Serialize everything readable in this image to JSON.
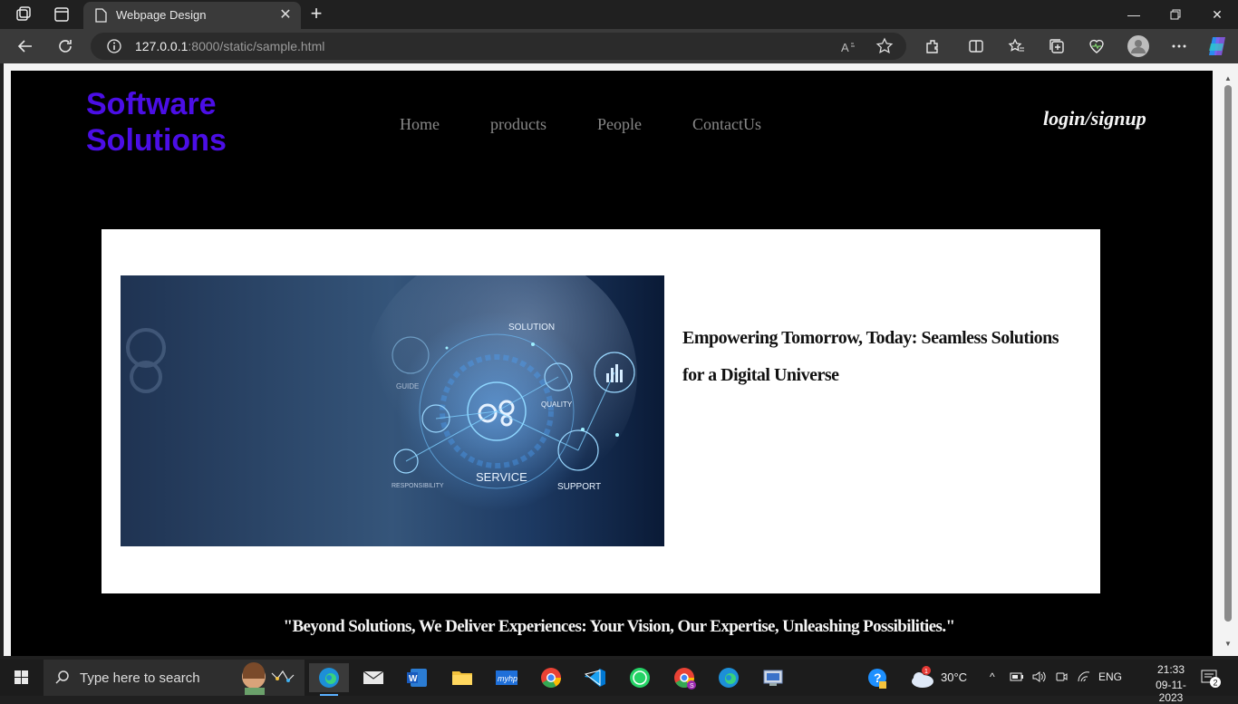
{
  "browser": {
    "tab_title": "Webpage Design",
    "url_host": "127.0.0.1",
    "url_rest": ":8000/static/sample.html",
    "accent": "#202020"
  },
  "site": {
    "brand_line1": "Software",
    "brand_line2": "Solutions",
    "brand_color": "#4b0ee6",
    "nav": [
      "Home",
      "products",
      "People",
      "ContactUs"
    ],
    "login": "login/signup",
    "hero_labels": {
      "solution": "SOLUTION",
      "guide": "GUIDE",
      "quality": "QUALITY",
      "service": "SERVICE",
      "responsibility": "RESPONSIBILITY",
      "support": "SUPPORT"
    },
    "tagline": "Empowering Tomorrow, Today: Seamless Solutions for a Digital Universe",
    "footer_quote": "\"Beyond Solutions, We Deliver Experiences: Your Vision, Our Expertise, Unleashing Possibilities.\""
  },
  "taskbar": {
    "search_placeholder": "Type here to search",
    "weather_temp": "30°C",
    "weather_badge": "1",
    "language": "ENG",
    "time": "21:33",
    "date": "09-11-2023",
    "notification_count": "2"
  }
}
